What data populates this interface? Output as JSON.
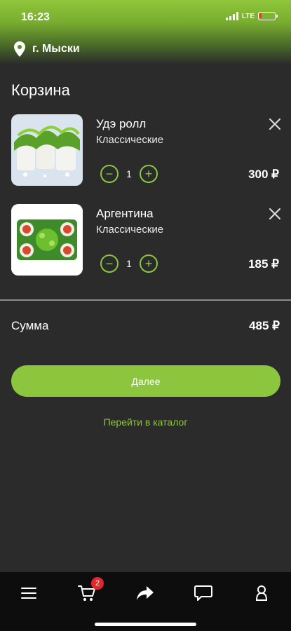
{
  "status_bar": {
    "time": "16:23",
    "network": "LTE"
  },
  "location": {
    "icon": "map-pin-icon",
    "city": "г. Мыски"
  },
  "page": {
    "title": "Корзина"
  },
  "cart": {
    "items": [
      {
        "name": "Удэ ролл",
        "category": "Классические",
        "quantity": "1",
        "price": "300 ₽"
      },
      {
        "name": "Аргентина",
        "category": "Классические",
        "quantity": "1",
        "price": "185 ₽"
      }
    ],
    "sum_label": "Сумма",
    "sum_value": "485 ₽"
  },
  "actions": {
    "next_label": "Далее",
    "catalog_label": "Перейти в каталог"
  },
  "tabbar": {
    "items": [
      "menu-icon",
      "cart-icon",
      "share-icon",
      "chat-icon",
      "profile-icon"
    ],
    "cart_badge": "2"
  },
  "colors": {
    "accent": "#8cc63f",
    "background": "#2b2b2b",
    "tabbar": "#0d0d0d",
    "badge": "#e3262c"
  }
}
